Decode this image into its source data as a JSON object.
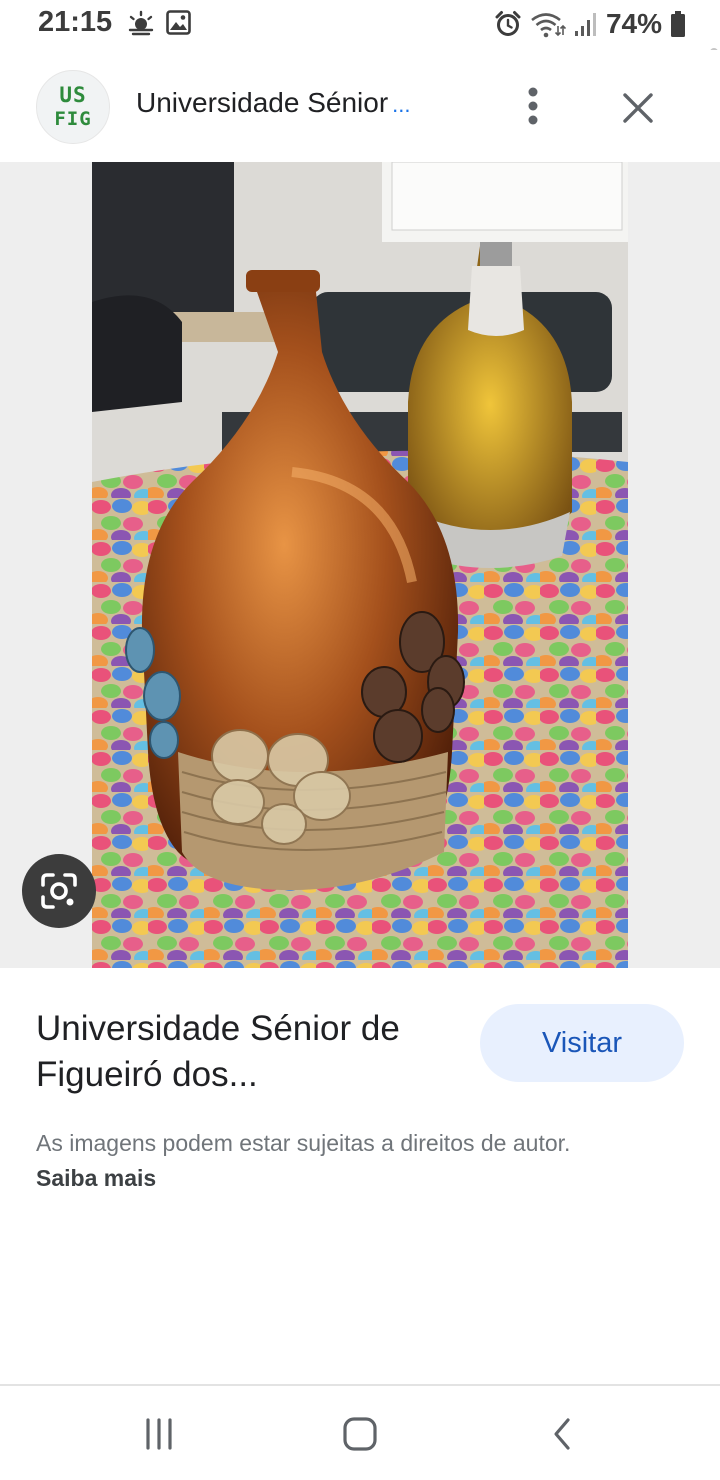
{
  "status_bar": {
    "time": "21:15",
    "battery_percent": "74%",
    "icons": [
      "weather-icon",
      "gallery-icon",
      "alarm-icon",
      "wifi-icon",
      "signal-icon",
      "battery-icon"
    ]
  },
  "header": {
    "logo_line1": "US",
    "logo_line2": "FIG",
    "title": "Universidade Sénior",
    "title_ellipsis": "...",
    "more_icon": "more-vert-icon",
    "close_icon": "close-icon"
  },
  "image": {
    "description_icon": "google-lens-icon"
  },
  "result": {
    "title": "Universidade Sénior de Figueiró dos...",
    "visit_label": "Visitar",
    "copyright_text": "As imagens podem estar sujeitas a direitos de autor.",
    "learn_more": "Saiba mais"
  },
  "nav_bar": {
    "icons": [
      "recents-icon",
      "home-icon",
      "back-icon"
    ]
  },
  "colors": {
    "accent_blue": "#1a73e8",
    "visit_button_bg": "#e8f0fe",
    "logo_green": "#2e8b3c"
  }
}
